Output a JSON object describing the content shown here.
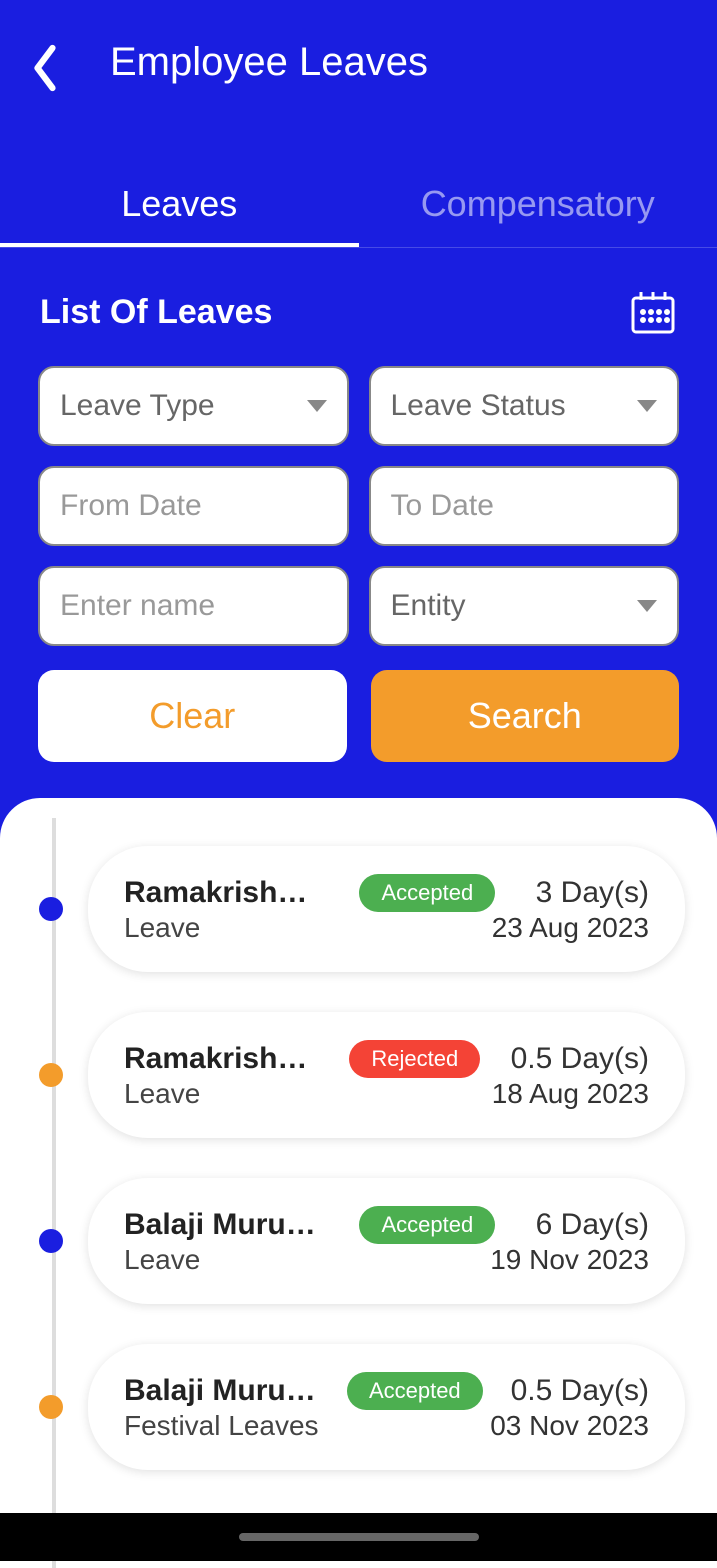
{
  "header": {
    "title": "Employee Leaves"
  },
  "tabs": {
    "leaves": "Leaves",
    "compensatory": "Compensatory"
  },
  "section": {
    "title": "List Of Leaves"
  },
  "filters": {
    "leaveType": "Leave Type",
    "leaveStatus": "Leave Status",
    "fromDate": "From Date",
    "toDate": "To Date",
    "enterName": "Enter name",
    "entity": "Entity"
  },
  "buttons": {
    "clear": "Clear",
    "search": "Search"
  },
  "leaves": [
    {
      "name": "Ramakrishn...",
      "status": "Accepted",
      "days": "3 Day(s)",
      "type": "Leave",
      "date": "23 Aug 2023",
      "dotColor": "blue"
    },
    {
      "name": "Ramakrishn...",
      "status": "Rejected",
      "days": "0.5 Day(s)",
      "type": "Leave",
      "date": "18 Aug 2023",
      "dotColor": "orange"
    },
    {
      "name": "Balaji Murug...",
      "status": "Accepted",
      "days": "6 Day(s)",
      "type": "Leave",
      "date": "19 Nov 2023",
      "dotColor": "blue"
    },
    {
      "name": "Balaji Murug...",
      "status": "Accepted",
      "days": "0.5 Day(s)",
      "type": "Festival Leaves",
      "date": "03 Nov 2023",
      "dotColor": "orange"
    }
  ]
}
